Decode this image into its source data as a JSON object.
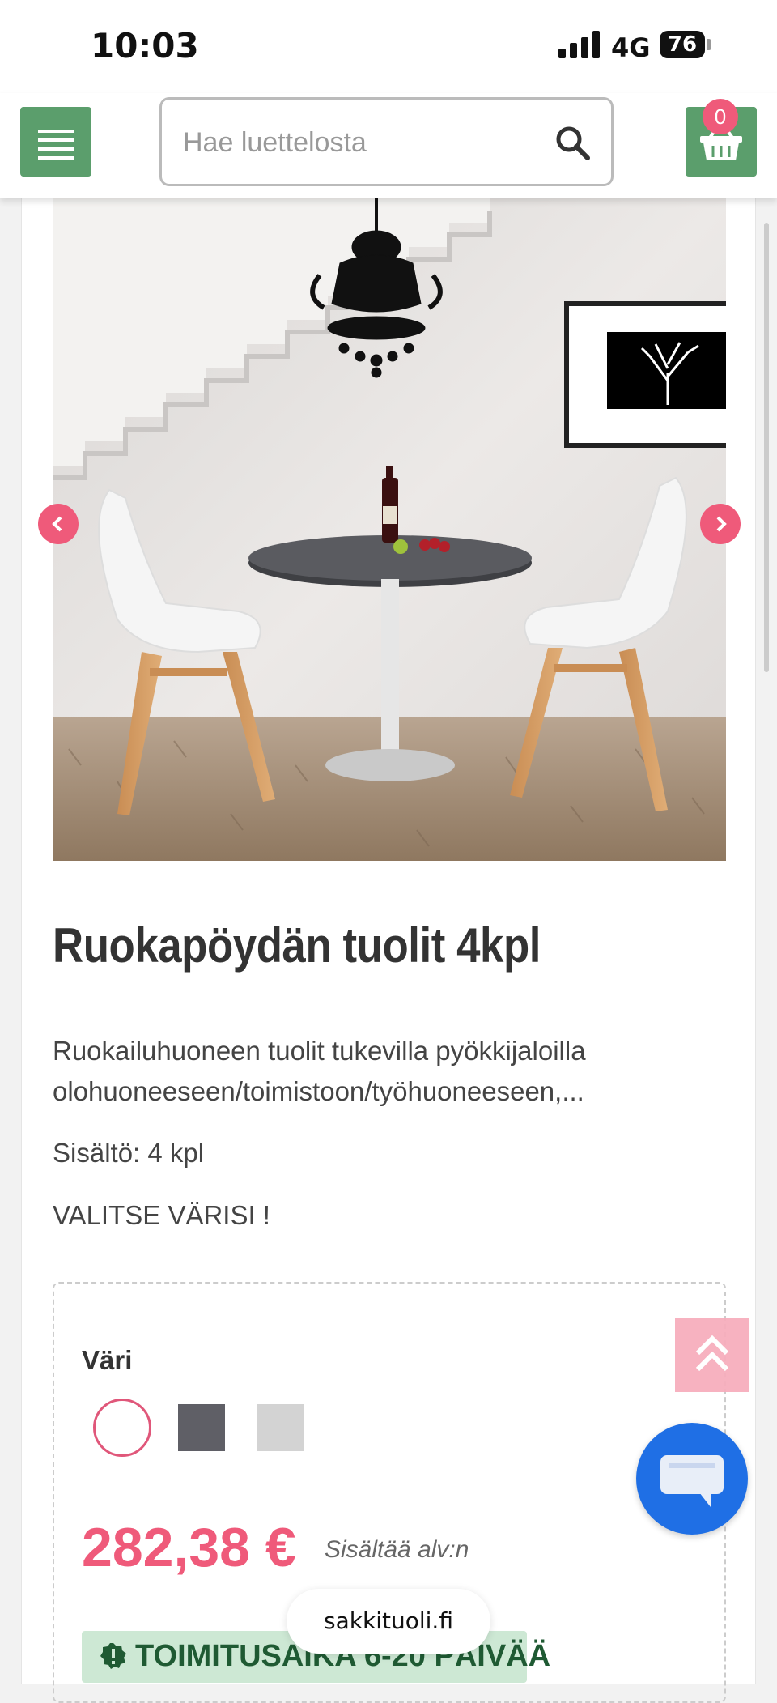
{
  "status_bar": {
    "time": "10:03",
    "network": "4G",
    "battery": "76"
  },
  "header": {
    "search": {
      "placeholder": "Hae luettelosta"
    },
    "cart_count": "0",
    "colors": {
      "green": "#5b9e6c",
      "pink": "#ef5a7a"
    }
  },
  "product": {
    "title": "Ruokapöydän tuolit 4kpl",
    "description": "Ruokailuhuoneen tuolit tukevilla pyökkijaloilla olohuoneeseen/toimistoon/työhuoneeseen,...",
    "contents": "Sisältö: 4 kpl",
    "choose_color": "VALITSE VÄRISI !",
    "color_label": "Väri",
    "swatches": [
      {
        "color": "#ffffff",
        "selected": true
      },
      {
        "color": "#5f5f66",
        "selected": false
      },
      {
        "color": "#d3d3d3",
        "selected": false
      }
    ],
    "price": "282,38 €",
    "vat_note": "Sisältää alv:n",
    "delivery": "TOIMITUSAIKA 6-20 PÄIVÄÄ"
  },
  "browser": {
    "url": "sakkituoli.fi"
  }
}
